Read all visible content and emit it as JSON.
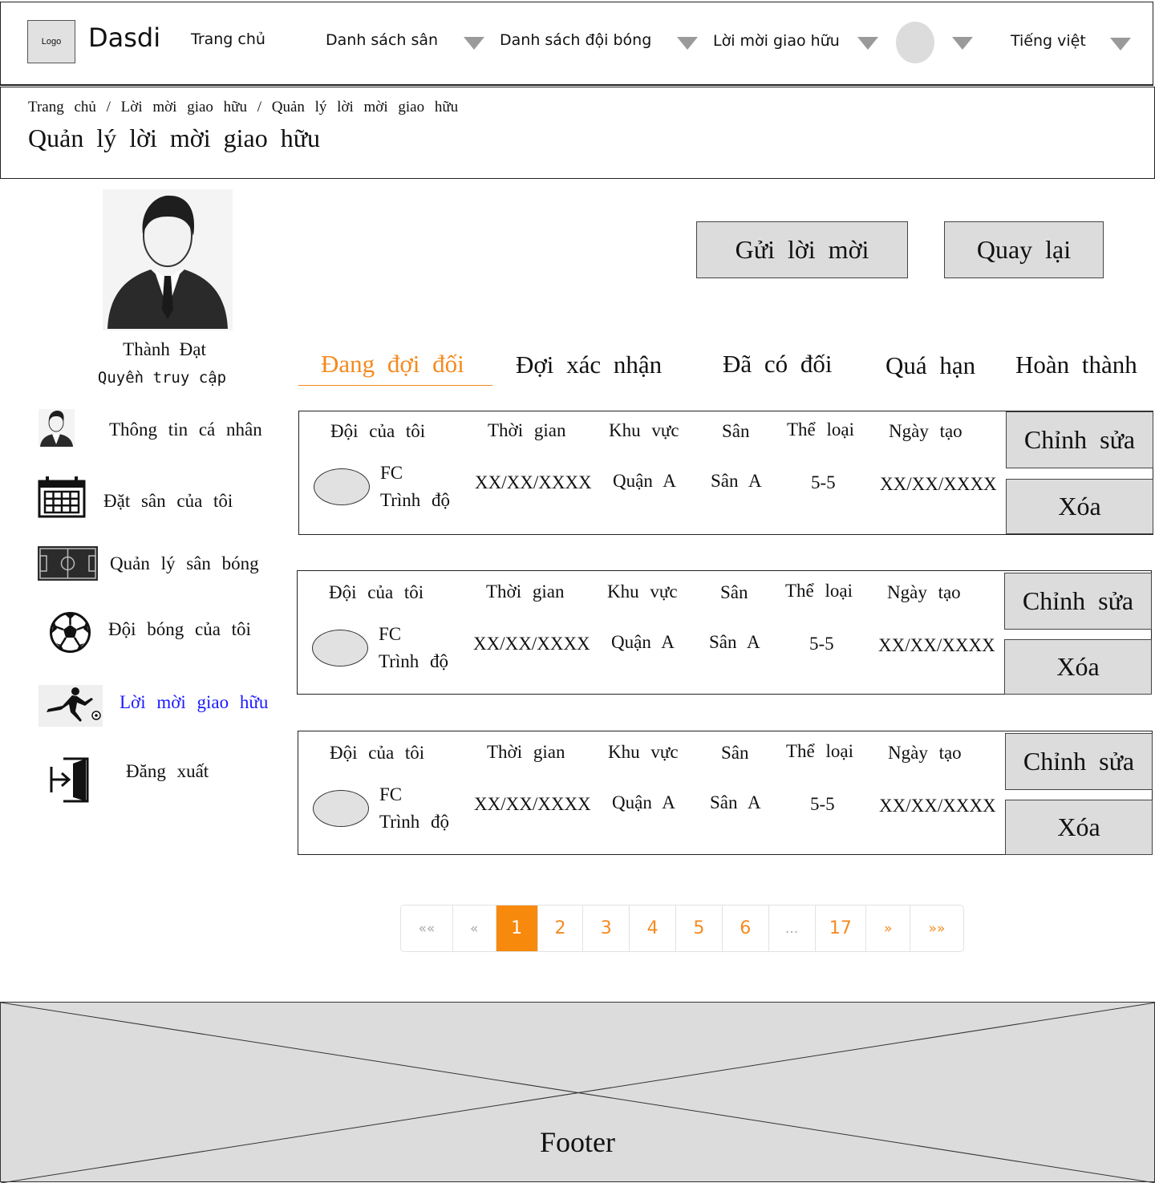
{
  "header": {
    "logo": "Logo",
    "brand": "Dasdi",
    "nav": {
      "home": "Trang chủ",
      "fields": "Danh sách sân",
      "teams": "Danh sách đội bóng",
      "invites": "Lời mời giao hữu",
      "language": "Tiếng việt"
    }
  },
  "breadcrumb": "Trang chủ / Lời mời giao hữu / Quản lý lời mời giao hữu",
  "page_title": "Quản lý lời mời giao hữu",
  "actions": {
    "send": "Gửi lời mời",
    "back": "Quay lại"
  },
  "profile": {
    "name": "Thành Đạt",
    "role": "Quyền truy cập"
  },
  "sidebar": [
    {
      "label": "Thông tin cá nhân",
      "icon": "person-icon"
    },
    {
      "label": "Đặt sân của tôi",
      "icon": "calendar-icon"
    },
    {
      "label": "Quản lý sân bóng",
      "icon": "soccer-field-icon"
    },
    {
      "label": "Đội bóng của tôi",
      "icon": "soccer-ball-icon"
    },
    {
      "label": "Lời mời giao hữu",
      "icon": "player-kick-icon",
      "active": true
    },
    {
      "label": "Đăng xuất",
      "icon": "logout-icon"
    }
  ],
  "tabs": [
    {
      "label": "Đang đợi đối",
      "active": true
    },
    {
      "label": "Đợi xác nhận"
    },
    {
      "label": "Đã có đối"
    },
    {
      "label": "Quá hạn"
    },
    {
      "label": "Hoàn thành"
    }
  ],
  "columns": [
    "Đội của tôi",
    "Thời gian",
    "Khu vực",
    "Sân",
    "Thể loại",
    "Ngày tạo"
  ],
  "invites": [
    {
      "team": "FC",
      "level": "Trình độ",
      "time": "XX/XX/XXXX",
      "area": "Quận A",
      "field": "Sân A",
      "type": "5-5",
      "created": "XX/XX/XXXX",
      "edit": "Chỉnh sửa",
      "delete": "Xóa"
    },
    {
      "team": "FC",
      "level": "Trình độ",
      "time": "XX/XX/XXXX",
      "area": "Quận A",
      "field": "Sân A",
      "type": "5-5",
      "created": "XX/XX/XXXX",
      "edit": "Chỉnh sửa",
      "delete": "Xóa"
    },
    {
      "team": "FC",
      "level": "Trình độ",
      "time": "XX/XX/XXXX",
      "area": "Quận A",
      "field": "Sân A",
      "type": "5-5",
      "created": "XX/XX/XXXX",
      "edit": "Chỉnh sửa",
      "delete": "Xóa"
    }
  ],
  "pagination": {
    "first": "««",
    "prev": "«",
    "pages": [
      "1",
      "2",
      "3",
      "4",
      "5",
      "6",
      "...",
      "17"
    ],
    "current": "1",
    "next": "»",
    "last": "»»"
  },
  "footer": "Footer",
  "colors": {
    "accent": "#f7890d",
    "active_link": "#1a1aff",
    "placeholder_gray": "#dcdcdc"
  }
}
